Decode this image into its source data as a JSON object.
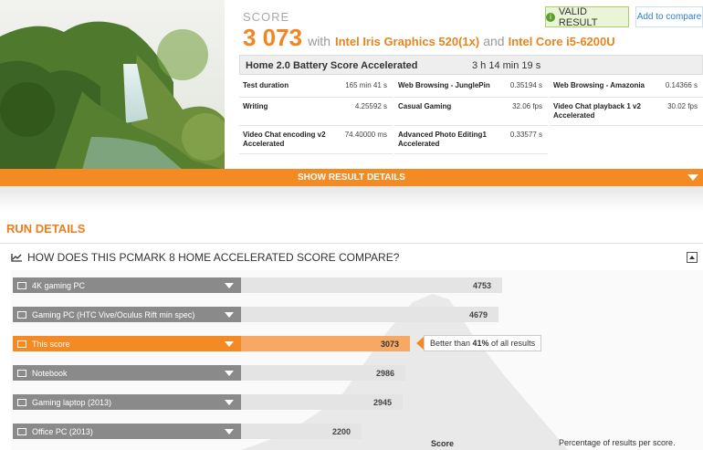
{
  "score": {
    "label": "SCORE",
    "value": "3 073",
    "with_text": "with",
    "gpu": "Intel Iris Graphics 520(1x)",
    "and_text": "and",
    "cpu": "Intel Core i5-6200U"
  },
  "actions": {
    "valid_result": "VALID RESULT",
    "add_to_compare": "Add to compare"
  },
  "table": {
    "header_title": "Home 2.0 Battery Score Accelerated",
    "header_value": "3 h 14 min 19 s",
    "cells": [
      {
        "label": "Test duration",
        "value": "165 min 41 s"
      },
      {
        "label": "Web Browsing - JunglePin",
        "value": "0.35194 s"
      },
      {
        "label": "Web Browsing - Amazonia",
        "value": "0.14366 s"
      },
      {
        "label": "Writing",
        "value": "4.25592 s"
      },
      {
        "label": "Casual Gaming",
        "value": "32.06 fps"
      },
      {
        "label": "Video Chat playback 1 v2 Accelerated",
        "value": "30.02 fps"
      },
      {
        "label": "Video Chat encoding v2 Accelerated",
        "value": "74.40000 ms"
      },
      {
        "label": "Advanced Photo Editing1 Accelerated",
        "value": "0.33577 s"
      }
    ]
  },
  "show_result_details": "SHOW RESULT DETAILS",
  "run_details": "RUN DETAILS",
  "compare_title": "HOW DOES THIS PCMARK 8 HOME ACCELERATED SCORE COMPARE?",
  "comparison": {
    "rows": [
      {
        "label": "4K gaming PC",
        "value": "4753",
        "highlight": false
      },
      {
        "label": "Gaming PC (HTC Vive/Oculus Rift min spec)",
        "value": "4679",
        "highlight": false
      },
      {
        "label": "This score",
        "value": "3073",
        "highlight": true
      },
      {
        "label": "Notebook",
        "value": "2986",
        "highlight": false
      },
      {
        "label": "Gaming laptop (2013)",
        "value": "2945",
        "highlight": false
      },
      {
        "label": "Office PC (2013)",
        "value": "2200",
        "highlight": false
      }
    ],
    "callout_prefix": "Better than ",
    "callout_pct": "41%",
    "callout_suffix": " of all results",
    "x_title": "Score",
    "pct_note": "Percentage of results per score."
  },
  "colors": {
    "accent": "#f48a23",
    "valid": "#5aa02c",
    "link": "#2f80c8"
  }
}
